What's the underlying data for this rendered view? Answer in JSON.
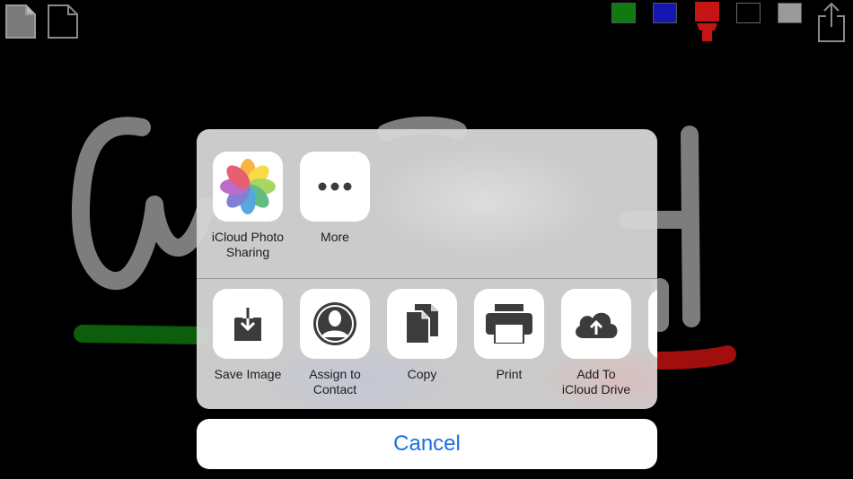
{
  "colors": {
    "background": "#000000",
    "stroke_gray": "#7d7d7d",
    "stroke_green": "#0c5e0c",
    "stroke_red": "#a00e0e",
    "accent_blue": "#1c6fe6"
  },
  "toolbar": {
    "page_icons": [
      "filled-page-icon",
      "blank-page-icon"
    ],
    "swatches": [
      {
        "name": "green",
        "color": "#107a10"
      },
      {
        "name": "blue",
        "color": "#1417b0"
      },
      {
        "name": "red-marker",
        "color": "#c51414"
      },
      {
        "name": "black",
        "color": "#000000"
      },
      {
        "name": "gray",
        "color": "#9a9a9a"
      }
    ],
    "share_icon": "share-icon"
  },
  "share_sheet": {
    "top_row": [
      {
        "label": "iCloud Photo\nSharing",
        "icon": "photos-icon"
      },
      {
        "label": "More",
        "icon": "more-icon"
      }
    ],
    "bottom_row": [
      {
        "label": "Save Image",
        "icon": "save-image-icon"
      },
      {
        "label": "Assign to\nContact",
        "icon": "contact-icon"
      },
      {
        "label": "Copy",
        "icon": "copy-icon"
      },
      {
        "label": "Print",
        "icon": "print-icon"
      },
      {
        "label": "Add To\niCloud Drive",
        "icon": "icloud-drive-icon"
      }
    ]
  },
  "cancel_label": "Cancel"
}
